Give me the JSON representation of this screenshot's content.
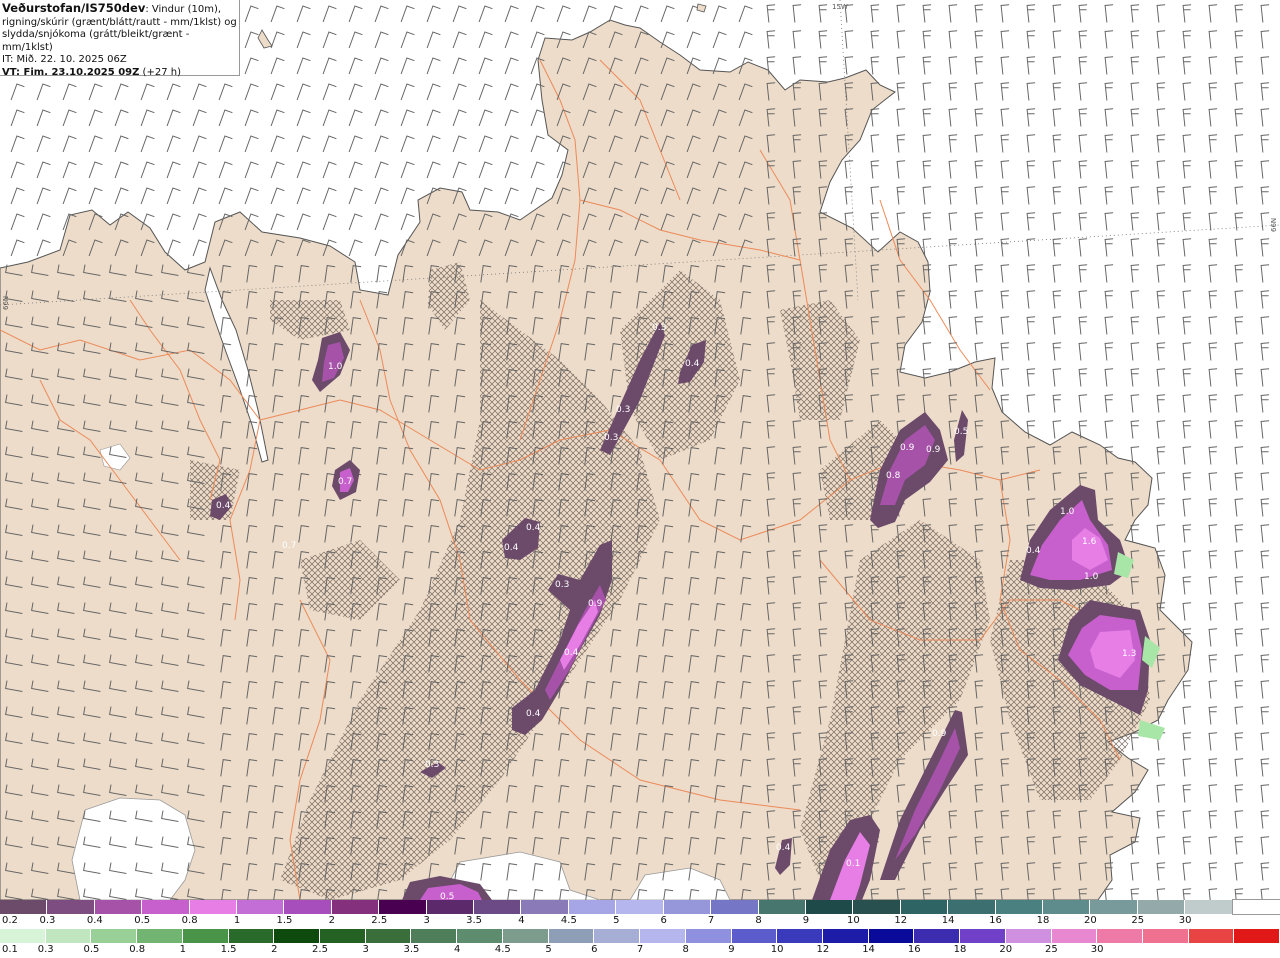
{
  "header": {
    "title": "Veðurstofan/IS750dev",
    "subtitle_part1": ": Vindur (10m),",
    "subtitle_line2": "rigning/skúrir (grænt/blátt/rautt - mm/1klst) og",
    "subtitle_line3": "slydda/snjókoma (grátt/bleikt/grænt - mm/1klst)",
    "init_time": "IT: Mið. 22. 10. 2025 06Z",
    "valid_prefix": "VT: Fim. 23.10.2025 09Z",
    "valid_suffix": " (+27 h)"
  },
  "map": {
    "grid_labels": {
      "lon": "15W",
      "lat_left": "66N",
      "lat_right": "66N"
    },
    "colors": {
      "land": "#eddcc9",
      "sea": "#ffffff",
      "roads": "#ec8a5a",
      "coast": "#555555",
      "barbs": "#666666",
      "glacier": "#ffffff",
      "hatch": "#7a6a60"
    },
    "precip_labels": [
      {
        "text": "1.0"
      },
      {
        "text": "0.7"
      },
      {
        "text": "0.4"
      },
      {
        "text": "0.7"
      },
      {
        "text": "0.3"
      },
      {
        "text": "0.4"
      },
      {
        "text": "0.3"
      },
      {
        "text": "0.9"
      },
      {
        "text": "0.4"
      },
      {
        "text": "0.4"
      },
      {
        "text": "0.4"
      },
      {
        "text": "0.3"
      },
      {
        "text": "0.3"
      },
      {
        "text": "0.3"
      },
      {
        "text": "0.4"
      },
      {
        "text": "0.9"
      },
      {
        "text": "0.9"
      },
      {
        "text": "0.8"
      },
      {
        "text": "0.5"
      },
      {
        "text": "1.0"
      },
      {
        "text": "1.6"
      },
      {
        "text": "0.4"
      },
      {
        "text": "1.0"
      },
      {
        "text": "1.3"
      },
      {
        "text": "0.9"
      },
      {
        "text": "0.1"
      },
      {
        "text": "0.4"
      },
      {
        "text": "0.5"
      }
    ]
  },
  "legend_rain": {
    "colors": [
      "#6b4a6a",
      "#7d4d82",
      "#a552a8",
      "#c760cc",
      "#e67ee6",
      "#c26ed6",
      "#a84ebc",
      "#84307c",
      "#4a0050",
      "#5c2a6a",
      "#6c4a86",
      "#8a7ab8",
      "#a6a6e6",
      "#b6b6ee",
      "#9696da",
      "#7676c6",
      "#46766e",
      "#1e4a4a",
      "#28504e",
      "#2f6464",
      "#3c7070",
      "#4a8080",
      "#5e8c8c",
      "#789a9a",
      "#94aaaa",
      "#c0cccc",
      "#ffffff"
    ],
    "labels": [
      "0.2",
      "0.3",
      "0.4",
      "0.5",
      "0.8",
      "1",
      "1.5",
      "2",
      "2.5",
      "3",
      "3.5",
      "4",
      "4.5",
      "5",
      "6",
      "7",
      "8",
      "9",
      "10",
      "12",
      "14",
      "16",
      "18",
      "20",
      "25",
      "30"
    ]
  },
  "legend_snow": {
    "colors": [
      "#d8f4d8",
      "#bfe6bf",
      "#98d098",
      "#72b472",
      "#4a944a",
      "#2a6a2a",
      "#0e4a0e",
      "#246224",
      "#3a6e3a",
      "#4e7e5a",
      "#5e8c6e",
      "#7e9c8e",
      "#8e9eb6",
      "#a6aed6",
      "#b6b6ee",
      "#9090e0",
      "#5c5ccc",
      "#3a3abc",
      "#1c1ca8",
      "#0a0a9a",
      "#3c2cb0",
      "#7040c8",
      "#d090e0",
      "#e888d0",
      "#ee7aa8",
      "#f07090",
      "#e84444",
      "#e01818"
    ],
    "labels": [
      "0.1",
      "0.3",
      "0.5",
      "0.8",
      "1",
      "1.5",
      "2",
      "2.5",
      "3",
      "3.5",
      "4",
      "4.5",
      "5",
      "6",
      "7",
      "8",
      "9",
      "10",
      "12",
      "14",
      "16",
      "18",
      "20",
      "25",
      "30"
    ]
  }
}
